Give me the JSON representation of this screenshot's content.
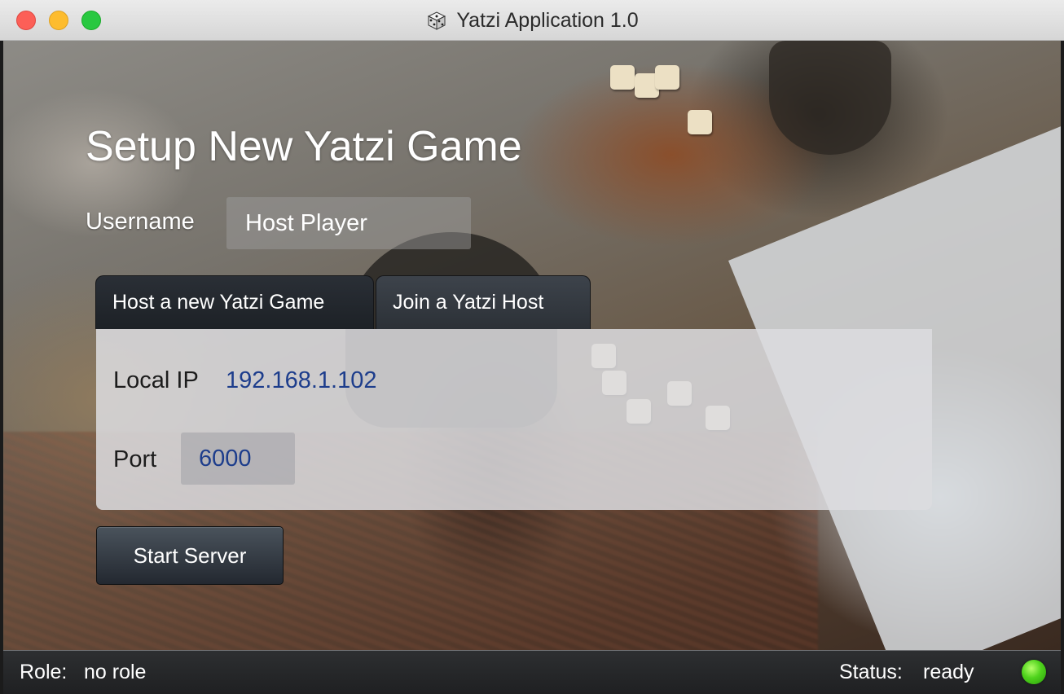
{
  "window": {
    "title": "Yatzi Application 1.0",
    "icon": "dice-icon"
  },
  "main": {
    "title": "Setup New Yatzi Game",
    "username_label": "Username",
    "username_value": "Host Player"
  },
  "tabs": [
    {
      "label": "Host a new Yatzi Game",
      "active": true
    },
    {
      "label": "Join a Yatzi Host",
      "active": false
    }
  ],
  "host_panel": {
    "local_ip_label": "Local IP",
    "local_ip_value": "192.168.1.102",
    "port_label": "Port",
    "port_value": "6000",
    "start_button_label": "Start Server"
  },
  "statusbar": {
    "role_label": "Role:",
    "role_value": "no role",
    "status_label": "Status:",
    "status_value": "ready",
    "indicator_color": "#4fd31c"
  },
  "colors": {
    "accent_text": "#1d3d8c",
    "tab_active": "#1d2126",
    "tab_inactive": "#2c3137"
  }
}
